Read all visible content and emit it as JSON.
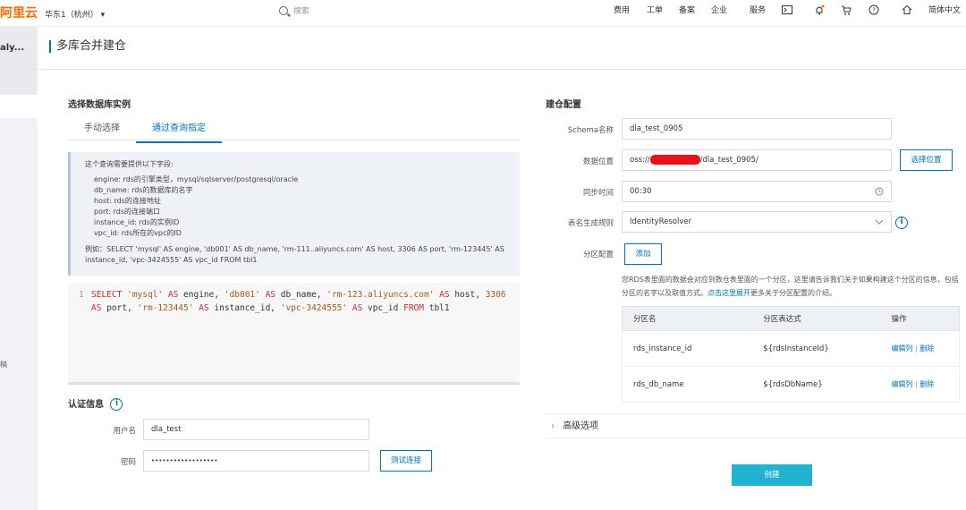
{
  "topbar": {
    "logo": "阿里云",
    "region": "华东1（杭州）",
    "search_placeholder": "搜索",
    "nav": [
      "费用",
      "工单",
      "备案",
      "企业",
      "服务"
    ],
    "language": "简体中文"
  },
  "sidebar": {
    "title": "aly...",
    "side_text": "稿"
  },
  "page": {
    "title": "多库合并建仓"
  },
  "left": {
    "section_title": "选择数据库实例",
    "tabs": [
      "手动选择",
      "通过查询指定"
    ],
    "info": {
      "heading": "这个查询需要提供以下字段:",
      "fields": [
        "engine: rds的引擎类型，mysql/sqlserver/postgresql/oracle",
        "db_name: rds的数据库的名字",
        "host: rds的连接地址",
        "port: rds的连接端口",
        "instance_id: rds的实例ID",
        "vpc_id: rds所在的vpc的ID"
      ],
      "example": "例如：SELECT 'mysql' AS engine, 'db001' AS db_name, 'rm-111..aliyuncs.com' AS host, 3306 AS port, 'rm-123445' AS instance_id, 'vpc-3424555' AS vpc_id FROM tbl1"
    },
    "editor": {
      "line_number": "1",
      "tokens": [
        {
          "t": "kw",
          "v": "SELECT"
        },
        {
          "t": "str",
          "v": "'mysql'"
        },
        {
          "t": "kw",
          "v": "AS"
        },
        {
          "t": "txt",
          "v": "engine,"
        },
        {
          "t": "str",
          "v": "'db001'"
        },
        {
          "t": "kw",
          "v": "AS"
        },
        {
          "t": "txt",
          "v": "db_name,"
        },
        {
          "t": "str",
          "v": "'rm-123.aliyuncs.com'"
        },
        {
          "t": "kw",
          "v": "AS"
        },
        {
          "t": "txt",
          "v": "host,"
        },
        {
          "t": "str",
          "v": "3306"
        },
        {
          "t": "kw",
          "v": "AS"
        },
        {
          "t": "txt",
          "v": "port,"
        },
        {
          "t": "str",
          "v": "'rm-123445'"
        },
        {
          "t": "kw",
          "v": "AS"
        },
        {
          "t": "txt",
          "v": "instance_id,"
        },
        {
          "t": "str",
          "v": "'vpc-3424555'"
        },
        {
          "t": "kw",
          "v": "AS"
        },
        {
          "t": "txt",
          "v": "vpc_id"
        },
        {
          "t": "kw",
          "v": "FROM"
        },
        {
          "t": "txt",
          "v": "tbl1"
        }
      ]
    },
    "auth": {
      "title": "认证信息",
      "username_label": "用户名",
      "username_value": "dla_test",
      "password_label": "密码",
      "password_value": "••••••••••••••••••",
      "test_button": "测试连接"
    }
  },
  "right": {
    "section_title": "建仓配置",
    "schema_label": "Schema名称",
    "schema_value": "dla_test_0905",
    "location_label": "数据位置",
    "location_prefix": "oss://",
    "location_suffix": "/dla_test_0905/",
    "location_button": "选择位置",
    "sync_label": "同步时间",
    "sync_value": "00:30",
    "rule_label": "表名生成规则",
    "rule_value": "IdentityResolver",
    "partition_label": "分区配置",
    "add_button": "添加",
    "note_text": "您RDS表里面的数据会对应到数仓表里面的一个分区，这里请告诉我们关于如果构建这个分区的信息，包括分区的名字以及取值方式。",
    "note_link": "点击这里展开",
    "note_tail": "更多关于分区配置的介绍。",
    "table": {
      "headers": [
        "分区名",
        "分区表达式",
        "操作"
      ],
      "rows": [
        {
          "name": "rds_instance_id",
          "expr": "${rdsInstanceId}",
          "edit": "编辑列",
          "sep": "|",
          "del": "删除"
        },
        {
          "name": "rds_db_name",
          "expr": "${rdsDbName}",
          "edit": "编辑列",
          "sep": "|",
          "del": "删除"
        }
      ]
    },
    "advanced": "高级选项",
    "create_button": "创建"
  }
}
